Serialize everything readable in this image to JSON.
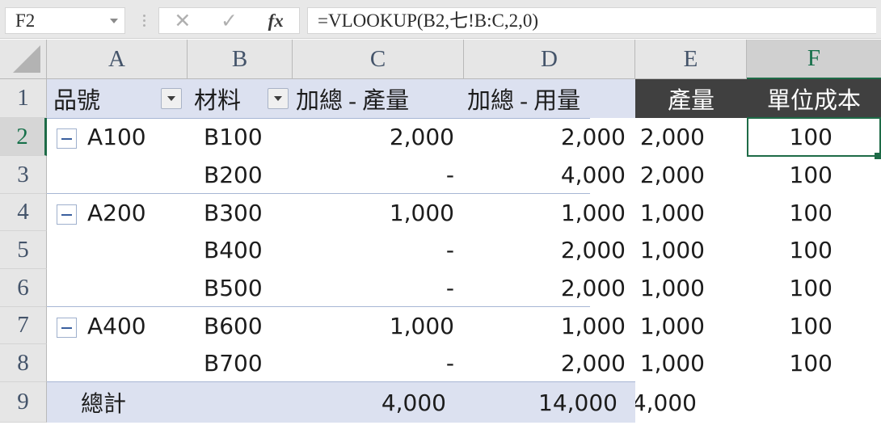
{
  "app": "spreadsheet",
  "formula_bar": {
    "name_box_value": "F2",
    "name_box_dropdown_icon": "chevron-down-icon",
    "grip_icon": "vertical-dots-grip-icon",
    "cancel_icon": "✕",
    "enter_icon": "✓",
    "function_icon": "fx",
    "formula_value": "=VLOOKUP(B2,七!B:C,2,0)"
  },
  "grid": {
    "select_all_icon": "select-all-triangle-icon",
    "column_headers": [
      {
        "letter": "A",
        "selected": false
      },
      {
        "letter": "B",
        "selected": false
      },
      {
        "letter": "C",
        "selected": false
      },
      {
        "letter": "D",
        "selected": false
      },
      {
        "letter": "E",
        "selected": false
      },
      {
        "letter": "F",
        "selected": true
      }
    ],
    "row_headers": [
      {
        "number": "1",
        "selected": false
      },
      {
        "number": "2",
        "selected": true
      },
      {
        "number": "3",
        "selected": false
      },
      {
        "number": "4",
        "selected": false
      },
      {
        "number": "5",
        "selected": false
      },
      {
        "number": "6",
        "selected": false
      },
      {
        "number": "7",
        "selected": false
      },
      {
        "number": "8",
        "selected": false
      },
      {
        "number": "9",
        "selected": false
      }
    ],
    "selected_cell": "F2",
    "filter_dropdown_icon": "filter-dropdown-icon",
    "collapse_icon": "minus-collapse-icon"
  },
  "table": {
    "headers": {
      "A": "品號",
      "B": "材料",
      "C": "加總 - 產量",
      "D": "加總 - 用量",
      "E": "產量",
      "F": "單位成本"
    },
    "rows": [
      {
        "row": "2",
        "A": "A100",
        "B": "B100",
        "C": "2,000",
        "D": "2,000",
        "E": "2,000",
        "F": "100",
        "group_start": true
      },
      {
        "row": "3",
        "A": "",
        "B": "B200",
        "C": "-",
        "D": "4,000",
        "E": "2,000",
        "F": "100",
        "group_start": false
      },
      {
        "row": "4",
        "A": "A200",
        "B": "B300",
        "C": "1,000",
        "D": "1,000",
        "E": "1,000",
        "F": "100",
        "group_start": true
      },
      {
        "row": "5",
        "A": "",
        "B": "B400",
        "C": "-",
        "D": "2,000",
        "E": "1,000",
        "F": "100",
        "group_start": false
      },
      {
        "row": "6",
        "A": "",
        "B": "B500",
        "C": "-",
        "D": "2,000",
        "E": "1,000",
        "F": "100",
        "group_start": false
      },
      {
        "row": "7",
        "A": "A400",
        "B": "B600",
        "C": "1,000",
        "D": "1,000",
        "E": "1,000",
        "F": "100",
        "group_start": true
      },
      {
        "row": "8",
        "A": "",
        "B": "B700",
        "C": "-",
        "D": "2,000",
        "E": "1,000",
        "F": "100",
        "group_start": false
      }
    ],
    "total_row": {
      "row": "9",
      "label": "總計",
      "B": "",
      "C": "4,000",
      "D": "14,000",
      "E": "4,000",
      "F": ""
    }
  },
  "colors": {
    "header_fill": "#dce1f0",
    "header_dark_fill": "#404040",
    "selection_green": "#1e6b47",
    "header_letter_blue": "#44546a",
    "group_line": "#a7b6d4"
  }
}
